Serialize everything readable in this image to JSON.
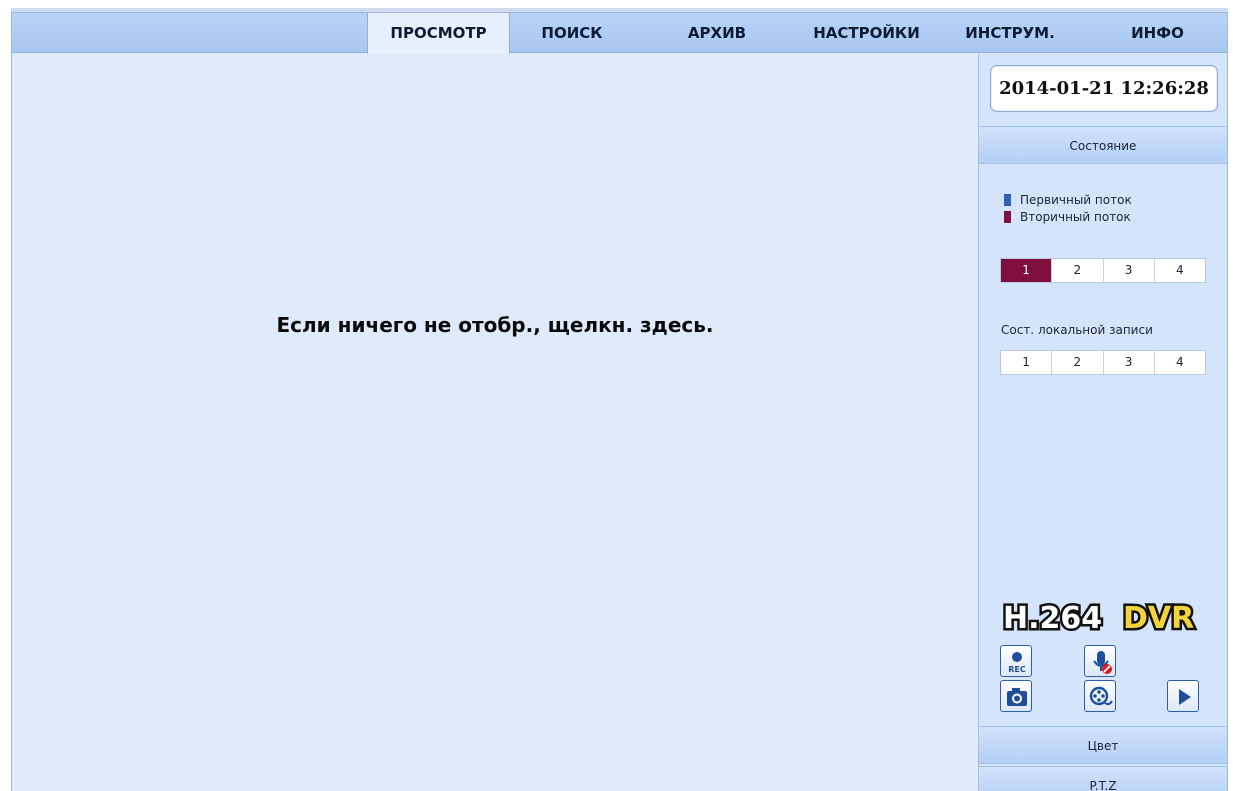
{
  "nav": {
    "tabs": [
      {
        "label": "ПРОСМОТР",
        "active": true
      },
      {
        "label": "ПОИСК",
        "active": false
      },
      {
        "label": "АРХИВ",
        "active": false
      },
      {
        "label": "НАСТРОЙКИ",
        "active": false
      },
      {
        "label": "ИНСТРУМ.",
        "active": false
      },
      {
        "label": "ИНФО",
        "active": false
      }
    ]
  },
  "viewer": {
    "hint": "Если ничего не отобр., щелкн. здесь."
  },
  "panel": {
    "datetime": "2014-01-21 12:26:28",
    "status_button": "Состояние",
    "legend": {
      "primary": {
        "label": "Первичный поток",
        "color": "#2f5fb3"
      },
      "secondary": {
        "label": "Вторичный поток",
        "color": "#7e0f3f"
      }
    },
    "stream_channels": [
      "1",
      "2",
      "3",
      "4"
    ],
    "stream_selected": "1",
    "record_state_label": "Сост. локальной записи",
    "record_channels": [
      "1",
      "2",
      "3",
      "4"
    ],
    "logo": {
      "part1": "H.264",
      "part2": "DVR"
    },
    "tools": {
      "record": {
        "icon": "rec-icon",
        "label": "REC"
      },
      "audio": {
        "icon": "microphone-muted-icon"
      },
      "snapshot": {
        "icon": "camera-icon"
      },
      "playback": {
        "icon": "film-reel-icon"
      },
      "play": {
        "icon": "play-icon"
      }
    },
    "color_button": "Цвет",
    "ptz_button": "P.T.Z"
  },
  "colors": {
    "nav_bg": "#b3cff4",
    "viewer_bg": "#dfeafb",
    "panel_bg": "#d4e4fa",
    "selected_channel": "#7e0f3f",
    "logo_yellow": "#f2d43a"
  }
}
